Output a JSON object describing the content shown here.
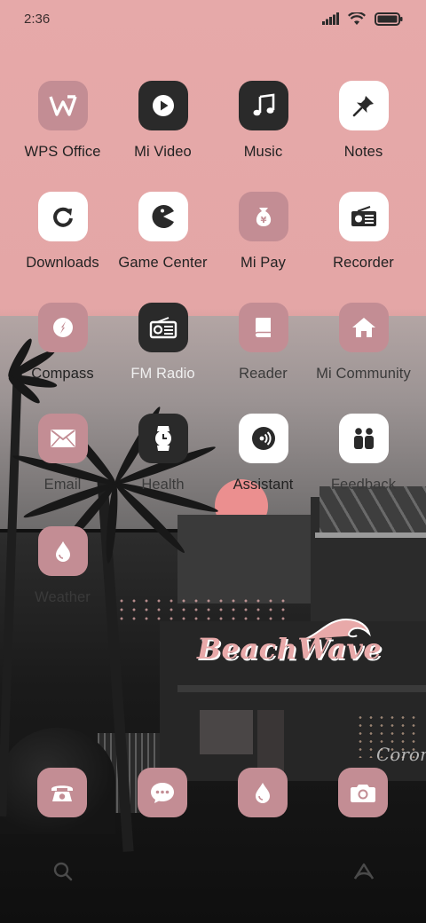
{
  "status_bar": {
    "time": "2:36"
  },
  "apps": [
    {
      "label": "WPS Office"
    },
    {
      "label": "Mi Video"
    },
    {
      "label": "Music"
    },
    {
      "label": "Notes"
    },
    {
      "label": "Downloads"
    },
    {
      "label": "Game Center"
    },
    {
      "label": "Mi Pay"
    },
    {
      "label": "Recorder"
    },
    {
      "label": "Compass"
    },
    {
      "label": "FM Radio"
    },
    {
      "label": "Reader"
    },
    {
      "label": "Mi Community"
    },
    {
      "label": "Email"
    },
    {
      "label": "Health"
    },
    {
      "label": "Assistant"
    },
    {
      "label": "Feedback"
    },
    {
      "label": "Weather"
    }
  ],
  "dock": [
    {
      "icon": "phone-icon"
    },
    {
      "icon": "messages-icon"
    },
    {
      "icon": "browser-icon"
    },
    {
      "icon": "camera-icon"
    }
  ],
  "wallpaper": {
    "logo_text": "BeachWave",
    "sign_text": "Coron"
  },
  "colors": {
    "icon_pink": "#c38d94",
    "icon_dark": "#2a2a2a",
    "sky_pink": "#e6a9a9"
  }
}
